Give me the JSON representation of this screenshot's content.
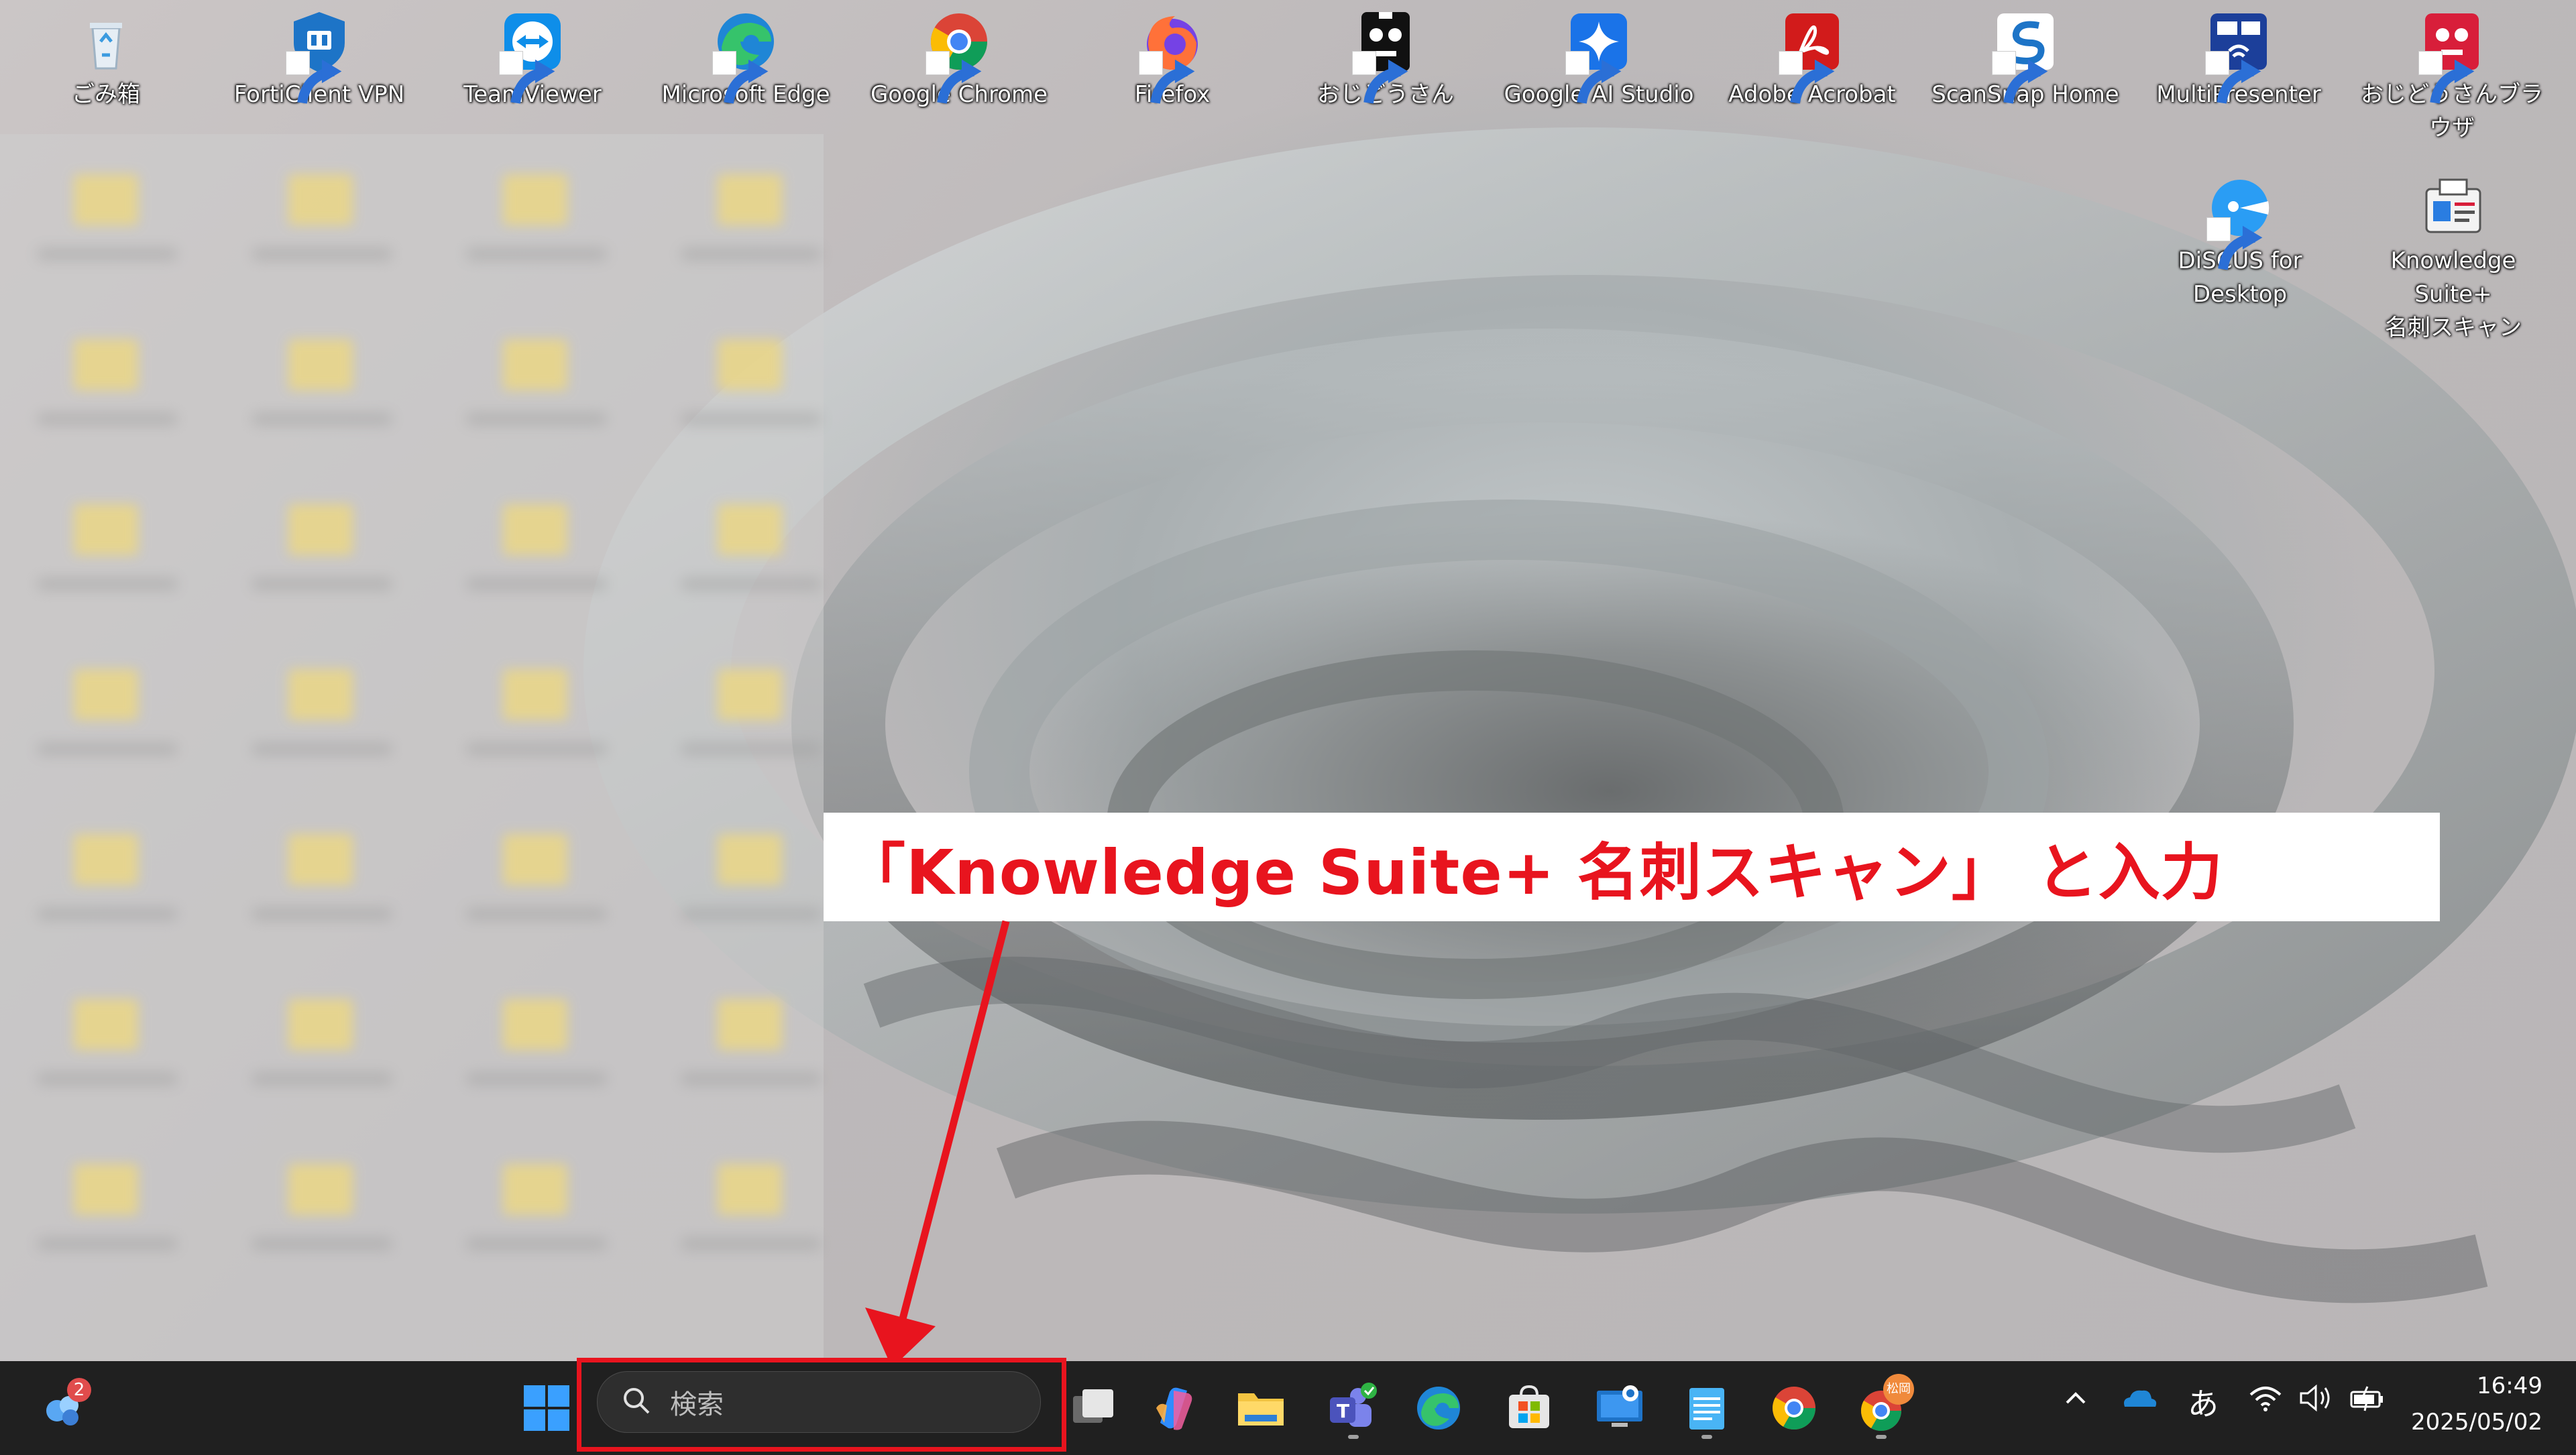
{
  "desktop": {
    "top_row": [
      {
        "name": "recycle-bin-icon",
        "label": "ごみ箱",
        "shortcut": false
      },
      {
        "name": "forticlient-vpn-icon",
        "label": "FortiClient VPN",
        "shortcut": true
      },
      {
        "name": "teamviewer-icon",
        "label": "TeamViewer",
        "shortcut": true
      },
      {
        "name": "microsoft-edge-icon",
        "label": "Microsoft Edge",
        "shortcut": true
      },
      {
        "name": "google-chrome-icon",
        "label": "Google Chrome",
        "shortcut": true
      },
      {
        "name": "firefox-icon",
        "label": "Firefox",
        "shortcut": true
      },
      {
        "name": "ojidousan-icon",
        "label": "おじどうさん",
        "shortcut": true
      },
      {
        "name": "google-ai-studio-icon",
        "label": "Google AI Studio",
        "shortcut": true
      },
      {
        "name": "adobe-acrobat-icon",
        "label": "Adobe Acrobat",
        "shortcut": true
      },
      {
        "name": "scansnap-home-icon",
        "label": "ScanSnap Home",
        "shortcut": true
      },
      {
        "name": "multipresenter-icon",
        "label": "MultiPresenter",
        "shortcut": true
      },
      {
        "name": "ojidousan-browser-icon",
        "label": "おじどうさんブラウザ",
        "shortcut": true
      }
    ],
    "second_row": [
      {
        "name": "discus-for-desktop-icon",
        "label": "DiSCUS for\nDesktop",
        "shortcut": true
      },
      {
        "name": "knowledge-suite-meishi-scan-icon",
        "label": "Knowledge Suite+\n名刺スキャン",
        "shortcut": false
      }
    ]
  },
  "callout": {
    "text": "「Knowledge Suite+ 名刺スキャン」 と入力",
    "color": "#e8141e"
  },
  "taskbar": {
    "widgets_badge": "2",
    "search_placeholder": "検索",
    "apps": [
      "task-view-icon",
      "copilot-icon",
      "file-explorer-icon",
      "teams-icon",
      "edge-icon",
      "microsoft-store-icon",
      "remote-desktop-icon",
      "notepad-icon",
      "chrome-icon",
      "chrome-profile-icon"
    ],
    "chrome_profile_badge": "松岡",
    "ime_indicator": "あ",
    "time": "16:49",
    "date": "2025/05/02"
  }
}
